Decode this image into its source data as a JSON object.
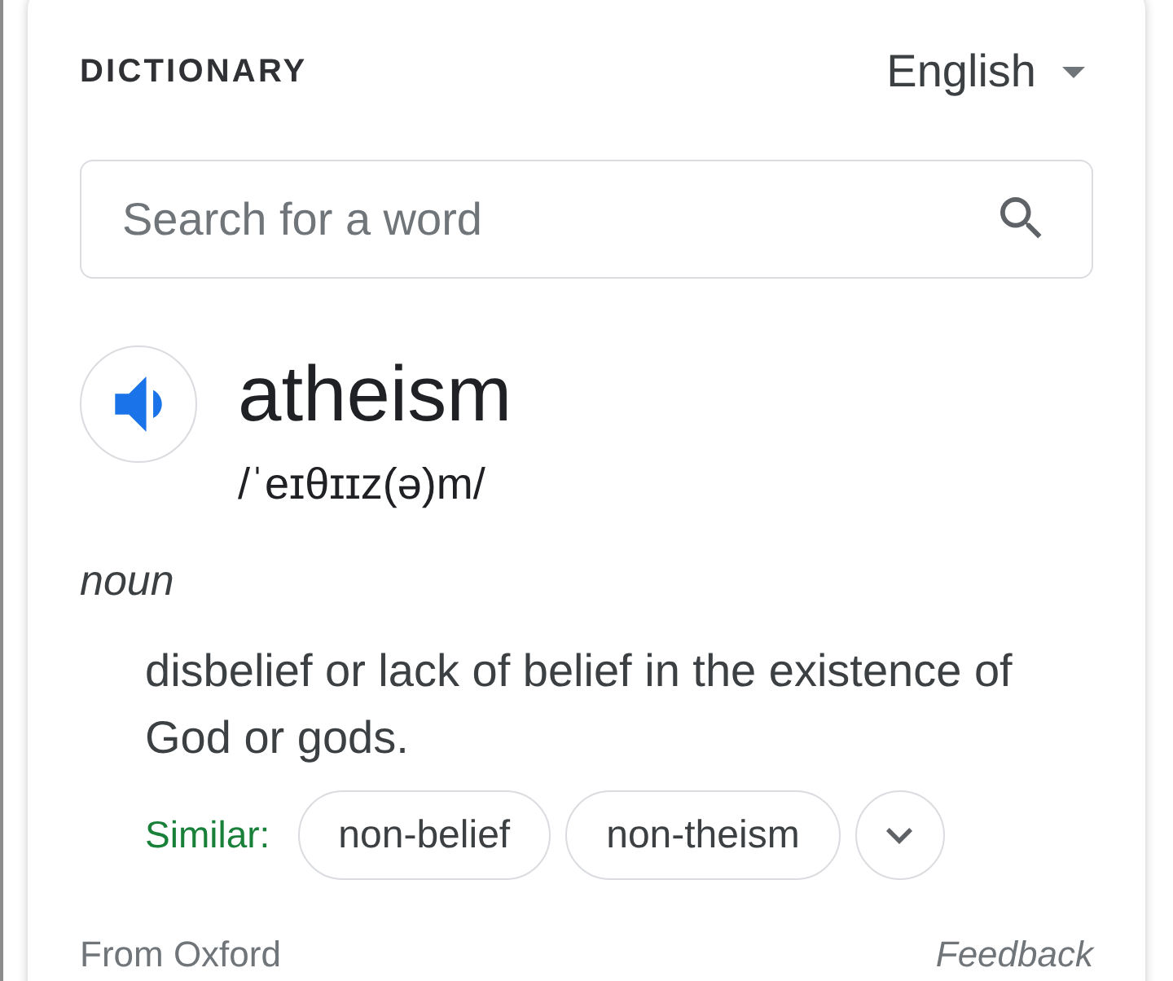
{
  "header": {
    "title": "DICTIONARY",
    "language": "English"
  },
  "search": {
    "placeholder": "Search for a word"
  },
  "entry": {
    "word": "atheism",
    "pronunciation": "/ˈeɪθɪɪz(ə)m/",
    "part_of_speech": "noun",
    "definition": "disbelief or lack of belief in the existence of God or gods.",
    "similar": {
      "label": "Similar:",
      "words": [
        "non-belief",
        "non-theism"
      ],
      "expanded": false
    }
  },
  "footer": {
    "source": "From Oxford",
    "feedback": "Feedback"
  }
}
